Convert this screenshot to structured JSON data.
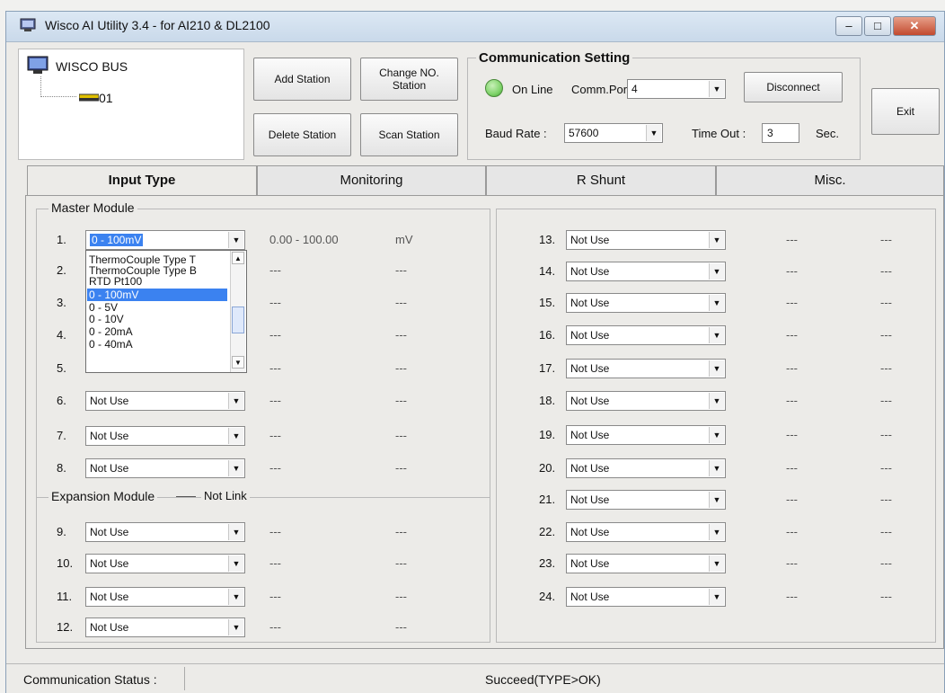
{
  "window": {
    "title": "Wisco AI Utility 3.4 - for AI210 & DL2100",
    "controls": {
      "minimize": "–",
      "maximize": "□",
      "close": "✕"
    }
  },
  "tree": {
    "root": "WISCO BUS",
    "child": "01"
  },
  "toolbar": {
    "add_station": "Add Station",
    "change_no_station": "Change NO. Station",
    "delete_station": "Delete Station",
    "scan_station": "Scan Station"
  },
  "comm": {
    "title": "Communication Setting",
    "status": "On Line",
    "port_label": "Comm.Port :",
    "port_value": "4",
    "disconnect": "Disconnect",
    "baud_label": "Baud Rate :",
    "baud_value": "57600",
    "timeout_label": "Time Out :",
    "timeout_value": "3",
    "timeout_unit": "Sec."
  },
  "exit_label": "Exit",
  "tabs": [
    "Input Type",
    "Monitoring",
    "R Shunt",
    "Misc."
  ],
  "master_title": "Master Module",
  "expansion_title": "Expansion Module",
  "expansion_status": "Not Link",
  "channels": [
    {
      "num": "1.",
      "value": "0 - 100mV",
      "range": "0.00 - 100.00",
      "unit": "mV"
    },
    {
      "num": "2.",
      "value": "",
      "range": "---",
      "unit": "---"
    },
    {
      "num": "3.",
      "value": "",
      "range": "---",
      "unit": "---"
    },
    {
      "num": "4.",
      "value": "",
      "range": "---",
      "unit": "---"
    },
    {
      "num": "5.",
      "value": "",
      "range": "---",
      "unit": "---"
    },
    {
      "num": "6.",
      "value": "Not Use",
      "range": "---",
      "unit": "---"
    },
    {
      "num": "7.",
      "value": "Not Use",
      "range": "---",
      "unit": "---"
    },
    {
      "num": "8.",
      "value": "Not Use",
      "range": "---",
      "unit": "---"
    },
    {
      "num": "9.",
      "value": "Not Use",
      "range": "---",
      "unit": "---"
    },
    {
      "num": "10.",
      "value": "Not Use",
      "range": "---",
      "unit": "---"
    },
    {
      "num": "11.",
      "value": "Not Use",
      "range": "---",
      "unit": "---"
    },
    {
      "num": "12.",
      "value": "Not Use",
      "range": "---",
      "unit": "---"
    },
    {
      "num": "13.",
      "value": "Not Use",
      "range": "---",
      "unit": "---"
    },
    {
      "num": "14.",
      "value": "Not Use",
      "range": "---",
      "unit": "---"
    },
    {
      "num": "15.",
      "value": "Not Use",
      "range": "---",
      "unit": "---"
    },
    {
      "num": "16.",
      "value": "Not Use",
      "range": "---",
      "unit": "---"
    },
    {
      "num": "17.",
      "value": "Not Use",
      "range": "---",
      "unit": "---"
    },
    {
      "num": "18.",
      "value": "Not Use",
      "range": "---",
      "unit": "---"
    },
    {
      "num": "19.",
      "value": "Not Use",
      "range": "---",
      "unit": "---"
    },
    {
      "num": "20.",
      "value": "Not Use",
      "range": "---",
      "unit": "---"
    },
    {
      "num": "21.",
      "value": "Not Use",
      "range": "---",
      "unit": "---"
    },
    {
      "num": "22.",
      "value": "Not Use",
      "range": "---",
      "unit": "---"
    },
    {
      "num": "23.",
      "value": "Not Use",
      "range": "---",
      "unit": "---"
    },
    {
      "num": "24.",
      "value": "Not Use",
      "range": "---",
      "unit": "---"
    }
  ],
  "dropdown_items": [
    "ThermoCouple Type T",
    "ThermoCouple Type B",
    "RTD Pt100",
    "0 - 100mV",
    "0 - 5V",
    "0 - 10V",
    "0 - 20mA",
    "0 - 40mA"
  ],
  "dropdown_selected_index": 3,
  "status": {
    "label": "Communication Status :",
    "message": "Succeed(TYPE>OK)"
  },
  "colors": {
    "online": "#7fd36a",
    "selection": "#3b82f0",
    "title_bar": "#c9d9ea"
  }
}
